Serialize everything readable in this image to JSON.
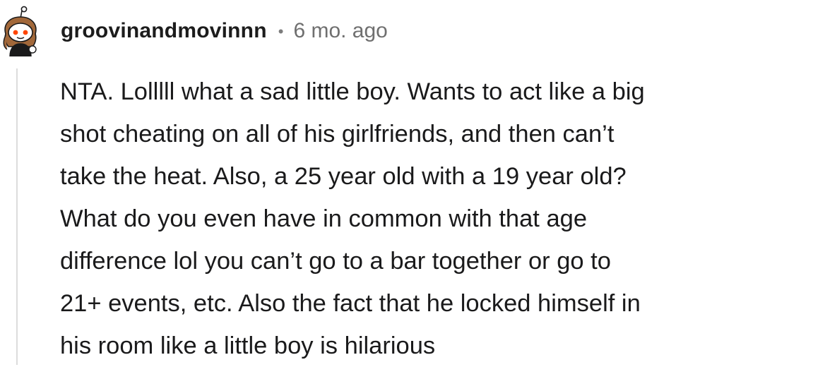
{
  "comment": {
    "author": "groovinandmovinnn",
    "separator": "•",
    "timestamp": "6 mo. ago",
    "body_lines": [
      "NTA. Lolllll what a sad little boy. Wants to act like a big",
      "shot cheating on all of his girlfriends, and then can’t",
      "take the heat. Also, a 25 year old with a 19 year old?",
      "What do you even have in common with that age",
      "difference lol you can’t go to a bar together or go to",
      "21+ events, etc. Also the fact that he locked himself in",
      "his room like a little boy is hilarious"
    ]
  },
  "colors": {
    "author": "#1c1c1c",
    "meta": "#6f6f6f",
    "thread_line": "#dcdcdc",
    "avatar_hair": "#a2683a",
    "avatar_eye": "#ff4500"
  },
  "icons": {
    "avatar": "reddit-snoo-avatar-icon"
  }
}
